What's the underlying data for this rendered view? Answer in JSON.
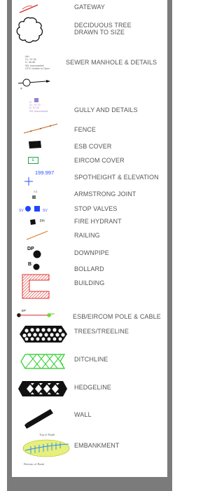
{
  "legend": {
    "items": [
      {
        "key": "gateway",
        "label": "GATEWAY",
        "icon": "gateway-icon"
      },
      {
        "key": "deciduous_tree",
        "label": "DECIDUOUS TREE\nDRAWN TO SIZE",
        "icon": "deciduous-tree-icon"
      },
      {
        "key": "sewer_manhole",
        "label": "SEWER MANHOLE & DETAILS",
        "icon": "sewer-manhole-icon"
      },
      {
        "key": "gully",
        "label": "GULLY AND DETAILS",
        "icon": "gully-icon"
      },
      {
        "key": "fence",
        "label": "FENCE",
        "icon": "fence-icon"
      },
      {
        "key": "esb_cover",
        "label": "ESB COVER",
        "icon": "esb-cover-icon"
      },
      {
        "key": "eircom_cover",
        "label": "EIRCOM COVER",
        "icon": "eircom-cover-icon"
      },
      {
        "key": "spotheight",
        "label": "SPOTHEIGHT & ELEVATION",
        "icon": "spotheight-icon"
      },
      {
        "key": "armstrong_joint",
        "label": "ARMSTRONG JOINT",
        "icon": "armstrong-joint-icon"
      },
      {
        "key": "stop_valves",
        "label": "STOP VALVES",
        "icon": "stop-valve-icon"
      },
      {
        "key": "fire_hydrant",
        "label": "FIRE HYDRANT",
        "icon": "fire-hydrant-icon"
      },
      {
        "key": "railing",
        "label": "RAILING",
        "icon": "railing-icon"
      },
      {
        "key": "downpipe",
        "label": "DOWNPIPE",
        "icon": "downpipe-icon"
      },
      {
        "key": "bollard",
        "label": "BOLLARD",
        "icon": "bollard-icon"
      },
      {
        "key": "building",
        "label": "BUILDING",
        "icon": "building-icon"
      },
      {
        "key": "pole_cable",
        "label": "ESB/EIRCOM POLE & CABLE",
        "icon": "pole-cable-icon"
      },
      {
        "key": "trees",
        "label": "TREES/TREELINE",
        "icon": "treeline-icon"
      },
      {
        "key": "ditchline",
        "label": "DITCHLINE",
        "icon": "ditchline-icon"
      },
      {
        "key": "hedgeline",
        "label": "HEDGELINE",
        "icon": "hedgeline-icon"
      },
      {
        "key": "wall",
        "label": "WALL",
        "icon": "wall-icon"
      },
      {
        "key": "embankment",
        "label": "EMBANKMENT",
        "icon": "embankment-icon"
      }
    ],
    "manhole_details": [
      "MH",
      "CL: 97.36",
      "IL: 96.58",
      "SN: Inaccessible",
      "UTO: Unable to Open"
    ],
    "gully_details": [
      "G",
      "CL: 97.70",
      "IL: 97.20",
      "SN: Inaccessible"
    ],
    "eircom_cover_text": "E",
    "spotheight_value": "199.997",
    "armstrong_text": "AJ",
    "stop_valve_text": [
      "SV",
      "SV"
    ],
    "fire_hydrant_text": "FH",
    "downpipe_text": "DP",
    "bollard_text": "B",
    "pole_text": [
      "EP",
      "EP"
    ],
    "embankment_text": {
      "top": "Top of Bank",
      "bottom": "Bottom of Bank"
    }
  },
  "colors": {
    "frame": "#7b7b7b",
    "label": "#555555",
    "gateway": "#d62828",
    "fence": "#c8621a",
    "eircom": "#22a34a",
    "spot": "#2c50ff",
    "building": "#e0302d",
    "ditch": "#22cc22",
    "embankment_fill": "#e6f07a",
    "embankment_line": "#2c8aff"
  }
}
